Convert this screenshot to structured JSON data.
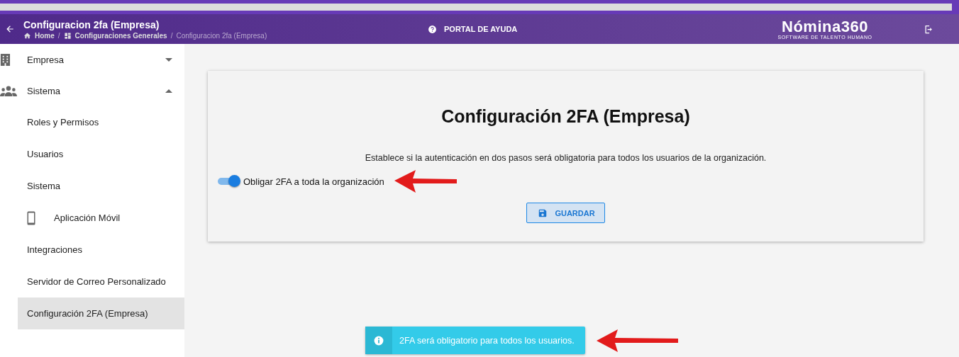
{
  "header": {
    "title": "Configuracion 2fa (Empresa)",
    "breadcrumb_separator": "/",
    "breadcrumbs": [
      {
        "label": "Home",
        "kind": "home"
      },
      {
        "label": "Configuraciones Generales",
        "kind": "dashboard"
      },
      {
        "label": "Configuracion 2fa (Empresa)",
        "kind": "current"
      }
    ],
    "help_link": "PORTAL DE AYUDA",
    "logo": {
      "name": "Nómina360",
      "tagline": "SOFTWARE DE TALENTO HUMANO"
    }
  },
  "sidebar": {
    "items": [
      {
        "label": "Empresa",
        "kind": "building",
        "expanded": false
      },
      {
        "label": "Sistema",
        "kind": "people",
        "expanded": true,
        "children": [
          {
            "label": "Roles y Permisos",
            "kind": "plain",
            "selected": false
          },
          {
            "label": "Usuarios",
            "kind": "plain",
            "selected": false
          },
          {
            "label": "Sistema",
            "kind": "plain",
            "selected": false
          },
          {
            "label": "Aplicación Móvil",
            "kind": "phone",
            "selected": false
          },
          {
            "label": "Integraciones",
            "kind": "plain",
            "selected": false
          },
          {
            "label": "Servidor de Correo Personalizado",
            "kind": "plain",
            "selected": false
          },
          {
            "label": "Configuración 2FA (Empresa)",
            "kind": "plain",
            "selected": true
          }
        ]
      }
    ]
  },
  "card": {
    "title": "Configuración 2FA (Empresa)",
    "description": "Establece si la autenticación en dos pasos será obligatoria para todos los usuarios de la organización.",
    "toggle": {
      "label": "Obligar 2FA a toda la organización",
      "on": true
    },
    "save_button": "GUARDAR"
  },
  "toast": {
    "message": "2FA será obligatorio para todos los usuarios."
  }
}
